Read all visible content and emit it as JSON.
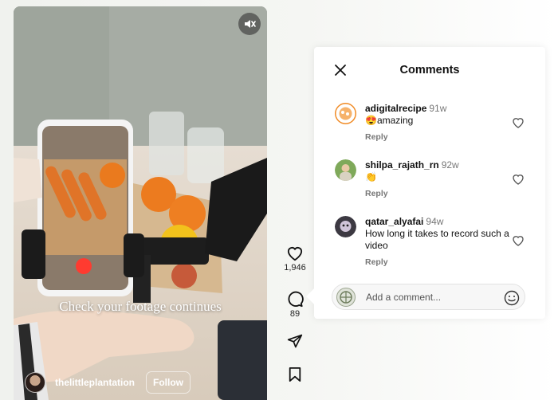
{
  "video": {
    "overlay_text": "Check your footage continues",
    "author": "thelittleplantation",
    "follow_label": "Follow"
  },
  "actions": {
    "likes": "1,946",
    "comments": "89"
  },
  "comments_panel": {
    "title": "Comments",
    "items": [
      {
        "user": "adigitalrecipe",
        "age": "91w",
        "text": "😍amazing",
        "reply": "Reply"
      },
      {
        "user": "shilpa_rajath_rn",
        "age": "92w",
        "text": "👏",
        "reply": "Reply"
      },
      {
        "user": "qatar_alyafai",
        "age": "94w",
        "text": "How long it takes to record such a video",
        "reply": "Reply"
      }
    ],
    "input_placeholder": "Add a comment..."
  },
  "icons": [
    "mute-icon",
    "close-icon",
    "heart-icon",
    "comment-icon",
    "share-icon",
    "bookmark-icon",
    "emoji-icon"
  ],
  "colors": {
    "accent_orange": "#f08a24",
    "reply_gray": "#777777"
  }
}
